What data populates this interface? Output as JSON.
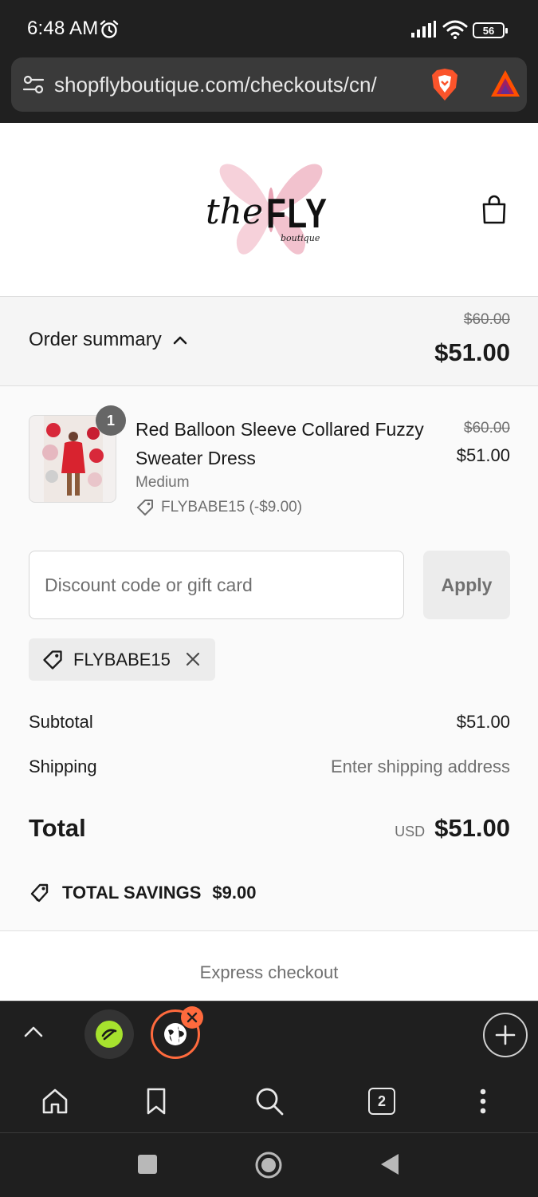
{
  "status": {
    "time": "6:48 AM",
    "battery": "56"
  },
  "browser": {
    "url": "shopflyboutique.com/checkouts/cn/"
  },
  "logo": {
    "the": "the",
    "fly": "FLY",
    "boutique": "boutique"
  },
  "summary": {
    "label": "Order summary",
    "old_price": "$60.00",
    "price": "$51.00"
  },
  "item": {
    "quantity": "1",
    "name": "Red Balloon Sleeve Collared Fuzzy Sweater Dress",
    "variant": "Medium",
    "discount": "FLYBABE15 (-$9.00)",
    "old_price": "$60.00",
    "price": "$51.00"
  },
  "discount": {
    "placeholder": "Discount code or gift card",
    "apply_label": "Apply",
    "applied_code": "FLYBABE15"
  },
  "totals": {
    "subtotal_label": "Subtotal",
    "subtotal": "$51.00",
    "shipping_label": "Shipping",
    "shipping": "Enter shipping address",
    "total_label": "Total",
    "currency": "USD",
    "total": "$51.00",
    "savings_label": "TOTAL SAVINGS",
    "savings": "$9.00"
  },
  "express_label": "Express checkout",
  "tabs": {
    "count": "2"
  },
  "colors": {
    "accent": "#ff6a3d",
    "chrome": "#1f1f1f",
    "panel": "#fafafa"
  }
}
